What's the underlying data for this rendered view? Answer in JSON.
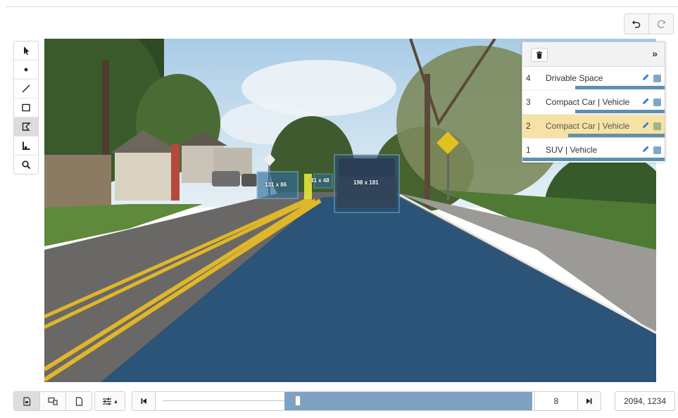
{
  "history": {
    "undo_icon": "undo-icon",
    "redo_icon": "redo-icon"
  },
  "tools": [
    {
      "name": "select",
      "icon": "cursor-icon",
      "active": false
    },
    {
      "name": "point",
      "icon": "point-icon",
      "active": false
    },
    {
      "name": "line",
      "icon": "line-icon",
      "active": false
    },
    {
      "name": "rectangle",
      "icon": "rectangle-icon",
      "active": false
    },
    {
      "name": "polygon",
      "icon": "polygon-icon",
      "active": true
    },
    {
      "name": "cuboid",
      "icon": "cuboid-icon",
      "active": false
    },
    {
      "name": "zoom",
      "icon": "magnifier-icon",
      "active": false
    }
  ],
  "boxes": [
    {
      "label": "131 x 86"
    },
    {
      "label": "41 x 48"
    },
    {
      "label": "198 x 181"
    }
  ],
  "panel": {
    "collapse_label": "»",
    "items": [
      {
        "num": "4",
        "label": "Drivable Space",
        "color": "#7fa8c8",
        "selected": false,
        "bar": [
          0.37,
          1.0
        ]
      },
      {
        "num": "3",
        "label": "Compact Car | Vehicle",
        "color": "#7fa8c8",
        "selected": false,
        "bar": [
          0.37,
          1.0
        ]
      },
      {
        "num": "2",
        "label": "Compact Car | Vehicle",
        "color": "#9fb48a",
        "selected": true,
        "bar": [
          0.32,
          1.0
        ]
      },
      {
        "num": "1",
        "label": "SUV | Vehicle",
        "color": "#7fa8c8",
        "selected": false,
        "bar": [
          0.0,
          1.0
        ]
      }
    ]
  },
  "bottom_left": {
    "view_buttons": [
      "image-view-icon",
      "multi-view-icon",
      "page-icon"
    ],
    "settings_icon": "sliders-icon",
    "caret": "▴"
  },
  "timeline": {
    "start_icon": "skip-start-icon",
    "end_icon": "skip-end-icon",
    "range": [
      0.34,
      0.995
    ],
    "position": 0.375,
    "frame": "8"
  },
  "coords": "2094, 1234"
}
